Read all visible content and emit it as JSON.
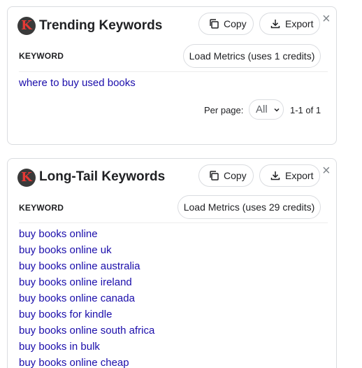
{
  "trending": {
    "title": "Trending Keywords",
    "copy_label": "Copy",
    "export_label": "Export",
    "close_symbol": "×",
    "column_header": "KEYWORD",
    "load_metrics_label": "Load Metrics (uses 1 credits)",
    "keywords": [
      "where to buy used books"
    ],
    "per_page_label": "Per page:",
    "per_page_value": "All",
    "range_text": "1-1 of 1"
  },
  "longtail": {
    "title": "Long-Tail Keywords",
    "copy_label": "Copy",
    "export_label": "Export",
    "close_symbol": "×",
    "column_header": "KEYWORD",
    "load_metrics_label": "Load Metrics (uses 29 credits)",
    "keywords": [
      "buy books online",
      "buy books online uk",
      "buy books online australia",
      "buy books online ireland",
      "buy books online canada",
      "buy books for kindle",
      "buy books online south africa",
      "buy books in bulk",
      "buy books online cheap"
    ]
  },
  "logo_letter": "K",
  "icons": {
    "logo": "keyword-tool-logo",
    "copy": "copy-icon",
    "export": "download-icon",
    "close": "close-icon",
    "dropdown": "chevron-down-icon"
  },
  "colors": {
    "link": "#1a0dab",
    "logo_bg": "#3a3a3a",
    "logo_letter": "#e53935",
    "border": "#dadce0"
  }
}
